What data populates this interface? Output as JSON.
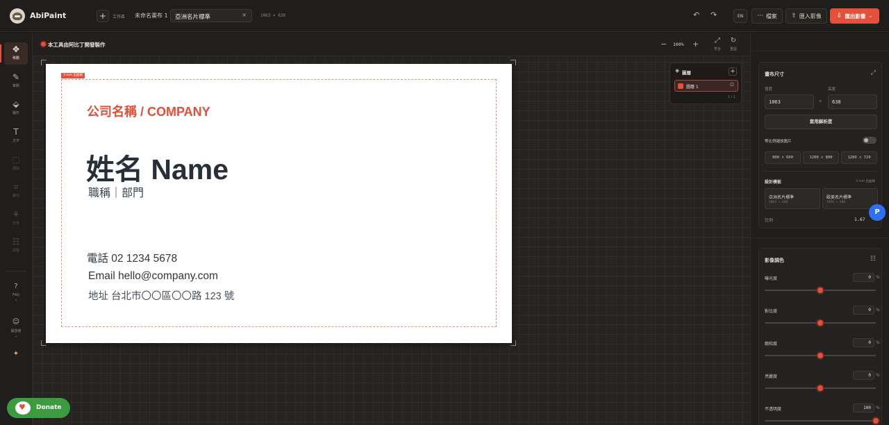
{
  "app": {
    "name": "AbiPaint"
  },
  "topbar": {
    "add_label": "+",
    "workspace_label": "工作區",
    "untitled": "未命名畫布 1",
    "tab_title": "亞洲名片標準",
    "tab_close": "×",
    "dimensions": "1063 × 638",
    "undo_icon": "↶",
    "redo_icon": "↷",
    "lang": "EN",
    "file_label": "檔案",
    "import_label": "匯入影像",
    "export_label": "匯出影像"
  },
  "tools": [
    {
      "label": "移動",
      "glyph": "✥"
    },
    {
      "label": "筆刷",
      "glyph": "✎"
    },
    {
      "label": "圖形",
      "glyph": "⬙"
    },
    {
      "label": "文字",
      "glyph": "T"
    },
    {
      "label": "選取",
      "glyph": "⬚"
    },
    {
      "label": "裁切",
      "glyph": "⌗"
    },
    {
      "label": "去背",
      "glyph": "⚘"
    },
    {
      "label": "調整",
      "glyph": "☷"
    }
  ],
  "bottom_tools": {
    "faq": "FAQ",
    "users": "開發者"
  },
  "canvas": {
    "credit": "本工具由阿比丁開發製作",
    "zoom": "100%",
    "fit_label": "符合",
    "reset_label": "重設",
    "bleed_tag": "3 mm 出血線"
  },
  "card": {
    "company": "公司名稱 / COMPANY",
    "name": "姓名 Name",
    "title": "職稱｜部門",
    "phone": "電話  02 1234 5678",
    "email": "Email  hello@company.com",
    "address": "地址  台北市〇〇區〇〇路 123 號"
  },
  "layers": {
    "title": "圖層",
    "add": "+",
    "layer_name": "圖層 1",
    "pager": "1 / 1"
  },
  "panel": {
    "canvas_size": {
      "title": "畫布尺寸",
      "width_label": "寬度",
      "height_label": "高度",
      "width": "1063",
      "height": "638",
      "times": "×",
      "apply": "套用解析度",
      "scale_label": "等比例縮放圖片",
      "presets": [
        "800 × 600",
        "1200 × 800",
        "1280 × 720"
      ]
    },
    "templates": {
      "title": "設計模板",
      "hint": "3 mm 出血線",
      "items": [
        {
          "name": "亞洲名片標準",
          "size": "1063 × 638"
        },
        {
          "name": "歐美名片標準",
          "size": "1050 × 600"
        }
      ],
      "ratio_label": "比例",
      "ratio_value": "1.67"
    },
    "adjust": {
      "title": "影像調色",
      "rows": [
        {
          "label": "曝光度",
          "value": "0",
          "unit": "%",
          "pos": 0.5
        },
        {
          "label": "對比度",
          "value": "0",
          "unit": "%",
          "pos": 0.5
        },
        {
          "label": "飽和度",
          "value": "0",
          "unit": "%",
          "pos": 0.5
        },
        {
          "label": "亮麗度",
          "value": "0",
          "unit": "%",
          "pos": 0.5
        },
        {
          "label": "不透明度",
          "value": "100",
          "unit": "%",
          "pos": 1.0
        }
      ]
    }
  },
  "floating": {
    "p_badge": "P",
    "donate": "Donate"
  },
  "colors": {
    "accent": "#e5503a",
    "badge": "#2f6ff2",
    "donate": "#3c9b3e"
  }
}
